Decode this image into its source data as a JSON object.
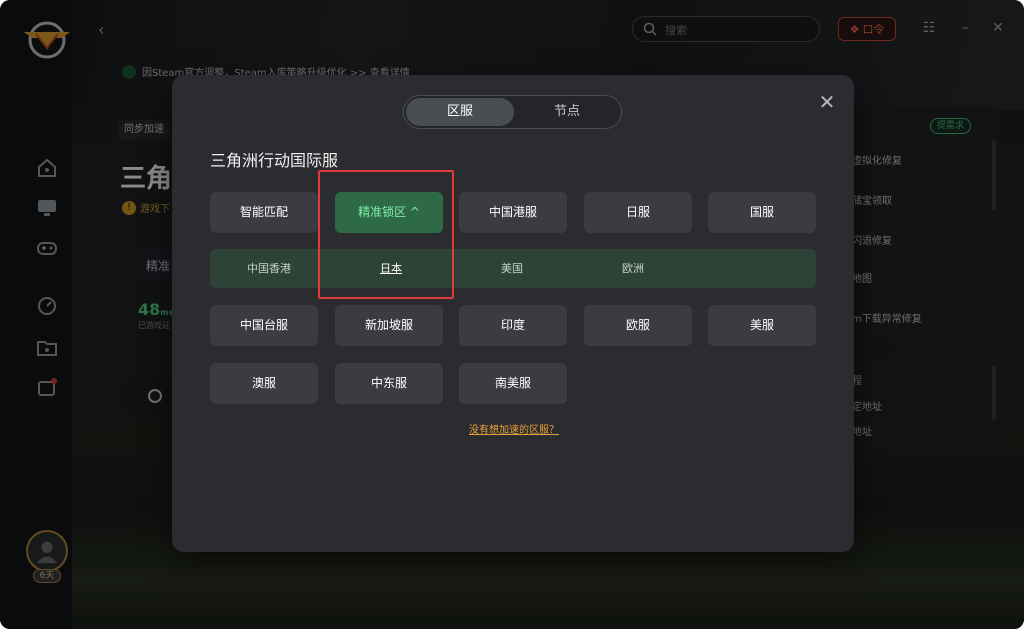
{
  "topbar": {
    "search_placeholder": "搜索",
    "promo_label": "口令",
    "window_controls": [
      "minimize-icon",
      "close-icon"
    ]
  },
  "background": {
    "breadcrumb": "因Steam官方调整，Steam入库策略升级优化 >> 查看详情",
    "sync_tag": "同步加速",
    "game_title": "三角",
    "warning": "游戏下",
    "select_value": "精准",
    "ping_value": "48",
    "ping_unit": "ms",
    "ping_sub": "已游戏延",
    "request_button": "提需求",
    "side_items": [
      "虚拟化修复",
      "储宝领取",
      "闪退修复",
      "地图",
      "m下载异常修复"
    ],
    "side_items2": [
      "程",
      "定地址",
      "地址"
    ],
    "avatar_badge": "6天"
  },
  "modal": {
    "tabs": [
      {
        "label": "区服",
        "active": true
      },
      {
        "label": "节点",
        "active": false
      }
    ],
    "title": "三角洲行动国际服",
    "regions_row1": [
      {
        "label": "智能匹配",
        "selected": false
      },
      {
        "label": "精准锁区 ^",
        "selected": true
      },
      {
        "label": "中国港服",
        "selected": false
      },
      {
        "label": "日服",
        "selected": false
      },
      {
        "label": "国服",
        "selected": false
      }
    ],
    "sub_regions": [
      {
        "label": "中国香港",
        "selected": false
      },
      {
        "label": "日本",
        "selected": true
      },
      {
        "label": "美国",
        "selected": false
      },
      {
        "label": "欧洲",
        "selected": false
      }
    ],
    "regions_row2": [
      {
        "label": "中国台服"
      },
      {
        "label": "新加坡服"
      },
      {
        "label": "印度"
      },
      {
        "label": "欧服"
      },
      {
        "label": "美服"
      }
    ],
    "regions_row3": [
      {
        "label": "澳服"
      },
      {
        "label": "中东服"
      },
      {
        "label": "南美服"
      }
    ],
    "help_link": "没有想加速的区服？"
  },
  "colors": {
    "accent_green": "#2f6a46",
    "highlight_red": "#e23b3b",
    "link_orange": "#e8a13a"
  }
}
